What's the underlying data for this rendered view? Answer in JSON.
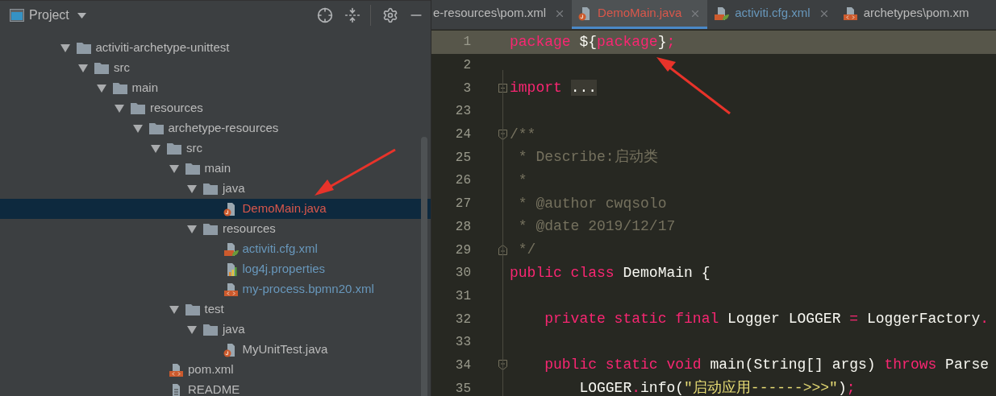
{
  "project_panel": {
    "title": "Project",
    "tree": [
      {
        "name": "activiti-archetype-unittest",
        "kind": "folder",
        "expanded": true,
        "selected": false,
        "color": "#bbbbbb",
        "children": [
          {
            "name": "src",
            "kind": "folder",
            "expanded": true,
            "selected": false,
            "color": "#bbbbbb",
            "children": [
              {
                "name": "main",
                "kind": "folder",
                "expanded": true,
                "selected": false,
                "color": "#bbbbbb",
                "children": [
                  {
                    "name": "resources",
                    "kind": "folder",
                    "expanded": true,
                    "selected": false,
                    "color": "#bbbbbb",
                    "children": [
                      {
                        "name": "archetype-resources",
                        "kind": "folder",
                        "expanded": true,
                        "selected": false,
                        "color": "#bbbbbb",
                        "children": [
                          {
                            "name": "src",
                            "kind": "folder",
                            "expanded": true,
                            "selected": false,
                            "color": "#bbbbbb",
                            "children": [
                              {
                                "name": "main",
                                "kind": "folder",
                                "expanded": true,
                                "selected": false,
                                "color": "#bbbbbb",
                                "children": [
                                  {
                                    "name": "java",
                                    "kind": "folder",
                                    "expanded": true,
                                    "selected": false,
                                    "color": "#bbbbbb",
                                    "children": [
                                      {
                                        "name": "DemoMain.java",
                                        "kind": "java",
                                        "selected": true,
                                        "unversioned": true,
                                        "modified": false
                                      }
                                    ]
                                  },
                                  {
                                    "name": "resources",
                                    "kind": "folder",
                                    "expanded": true,
                                    "selected": false,
                                    "color": "#bbbbbb",
                                    "children": [
                                      {
                                        "name": "activiti.cfg.xml",
                                        "kind": "spring-xml",
                                        "selected": false,
                                        "unversioned": false,
                                        "modified": true
                                      },
                                      {
                                        "name": "log4j.properties",
                                        "kind": "properties",
                                        "selected": false,
                                        "unversioned": false,
                                        "modified": true
                                      },
                                      {
                                        "name": "my-process.bpmn20.xml",
                                        "kind": "xml",
                                        "selected": false,
                                        "unversioned": false,
                                        "modified": true
                                      }
                                    ]
                                  }
                                ]
                              },
                              {
                                "name": "test",
                                "kind": "folder",
                                "expanded": true,
                                "selected": false,
                                "color": "#bbbbbb",
                                "children": [
                                  {
                                    "name": "java",
                                    "kind": "folder",
                                    "expanded": true,
                                    "selected": false,
                                    "color": "#bbbbbb",
                                    "children": [
                                      {
                                        "name": "MyUnitTest.java",
                                        "kind": "java",
                                        "selected": false,
                                        "unversioned": false,
                                        "modified": false
                                      }
                                    ]
                                  }
                                ]
                              }
                            ]
                          },
                          {
                            "name": "pom.xml",
                            "kind": "xml",
                            "selected": false,
                            "unversioned": false,
                            "modified": false
                          },
                          {
                            "name": "README",
                            "kind": "text",
                            "selected": false,
                            "unversioned": false,
                            "modified": false
                          }
                        ]
                      }
                    ]
                  }
                ]
              }
            ]
          }
        ]
      }
    ]
  },
  "tabs": [
    {
      "label": "e-resources\\pom.xml",
      "kind": "none",
      "selected": false,
      "color": "#bbbbbb",
      "closable": true
    },
    {
      "label": "DemoMain.java",
      "kind": "java",
      "selected": true,
      "color": "#d9574b",
      "closable": true
    },
    {
      "label": "activiti.cfg.xml",
      "kind": "spring-xml",
      "selected": false,
      "color": "#6897bb",
      "closable": true
    },
    {
      "label": "archetypes\\pom.xm",
      "kind": "xml",
      "selected": false,
      "color": "#bbbbbb",
      "closable": false
    }
  ],
  "code_lines": [
    {
      "number": "1",
      "highlighted": true,
      "tokens": [
        {
          "kind": "keyword",
          "text": "package"
        },
        {
          "kind": "plain",
          "text": " ${"
        },
        {
          "kind": "keyword",
          "text": "package"
        },
        {
          "kind": "plain",
          "text": "}"
        },
        {
          "kind": "keyword",
          "text": ";"
        }
      ]
    },
    {
      "number": "2",
      "highlighted": false
    },
    {
      "number": "3",
      "highlighted": false,
      "kind": "fold-collapsed",
      "tokens": [
        {
          "kind": "keyword",
          "text": "import "
        },
        {
          "kind": "folded",
          "text": "..."
        }
      ]
    },
    {
      "number": "23",
      "highlighted": false
    },
    {
      "number": "24",
      "highlighted": false,
      "kind": "fold-start",
      "tokens": [
        {
          "kind": "comment",
          "text": "/**"
        }
      ]
    },
    {
      "number": "25",
      "highlighted": false,
      "tokens": [
        {
          "kind": "comment",
          "text": " * Describe:启动类"
        }
      ]
    },
    {
      "number": "26",
      "highlighted": false,
      "tokens": [
        {
          "kind": "comment",
          "text": " *"
        }
      ]
    },
    {
      "number": "27",
      "highlighted": false,
      "tokens": [
        {
          "kind": "comment",
          "text": " * @author cwqsolo"
        }
      ]
    },
    {
      "number": "28",
      "highlighted": false,
      "tokens": [
        {
          "kind": "comment",
          "text": " * @date 2019/12/17"
        }
      ]
    },
    {
      "number": "29",
      "highlighted": false,
      "kind": "fold-end",
      "tokens": [
        {
          "kind": "comment",
          "text": " */"
        }
      ]
    },
    {
      "number": "30",
      "highlighted": false,
      "tokens": [
        {
          "kind": "keyword",
          "text": "public class"
        },
        {
          "kind": "plain",
          "text": " DemoMain {"
        }
      ]
    },
    {
      "number": "31",
      "highlighted": false
    },
    {
      "number": "32",
      "highlighted": false,
      "tokens": [
        {
          "kind": "keyword",
          "text": "    private static final"
        },
        {
          "kind": "plain",
          "text": " Logger LOGGER "
        },
        {
          "kind": "keyword",
          "text": "="
        },
        {
          "kind": "plain",
          "text": " LoggerFactory"
        },
        {
          "kind": "keyword",
          "text": "."
        }
      ]
    },
    {
      "number": "33",
      "highlighted": false
    },
    {
      "number": "34",
      "highlighted": false,
      "kind": "fold-start",
      "tokens": [
        {
          "kind": "keyword",
          "text": "    public static void"
        },
        {
          "kind": "plain",
          "text": " main(String[] args) "
        },
        {
          "kind": "keyword",
          "text": "throws"
        },
        {
          "kind": "plain",
          "text": " Parse"
        }
      ]
    },
    {
      "number": "35",
      "highlighted": false,
      "tokens": [
        {
          "kind": "plain",
          "text": "        LOGGER"
        },
        {
          "kind": "keyword",
          "text": "."
        },
        {
          "kind": "plain",
          "text": "info("
        },
        {
          "kind": "string",
          "text": "\"启动应用------>>>\""
        },
        {
          "kind": "plain",
          "text": ")"
        },
        {
          "kind": "keyword",
          "text": ";"
        }
      ]
    }
  ]
}
